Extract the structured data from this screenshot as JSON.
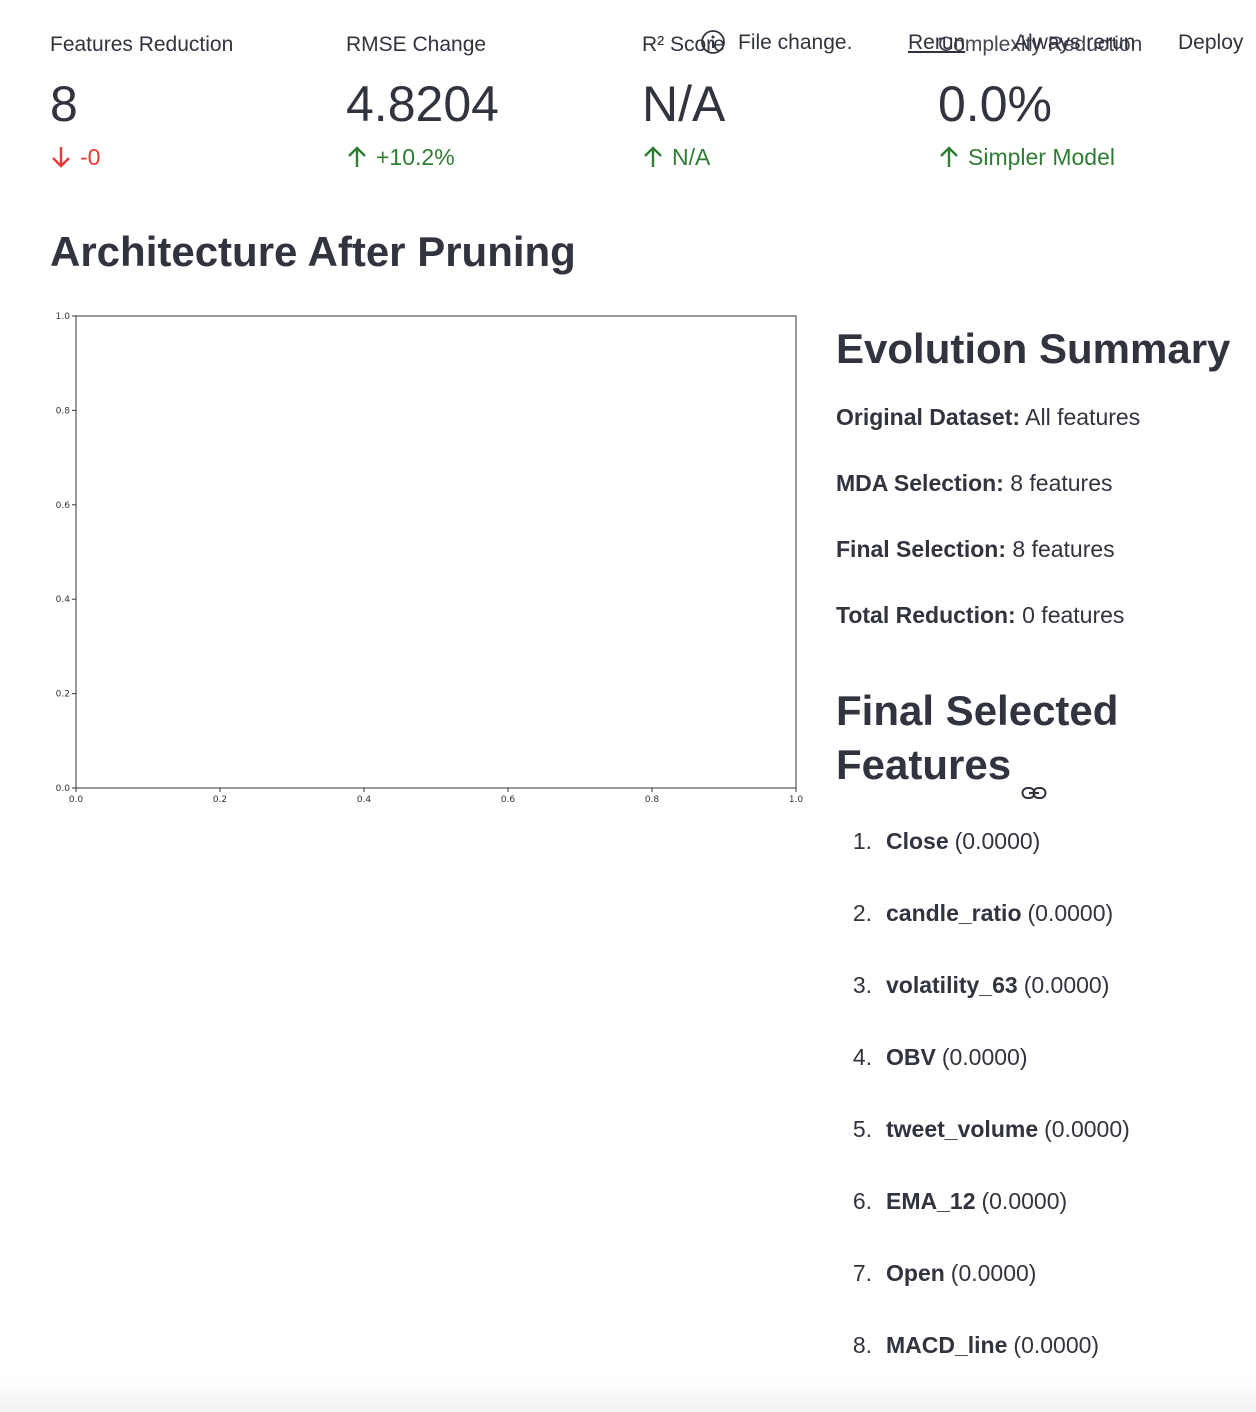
{
  "metrics": [
    {
      "label": "Features Reduction",
      "value": "8",
      "delta": "-0",
      "direction": "down"
    },
    {
      "label": "RMSE Change",
      "value": "4.8204",
      "delta": "+10.2%",
      "direction": "up"
    },
    {
      "label": "R² Score",
      "value": "N/A",
      "delta": "N/A",
      "direction": "up"
    },
    {
      "label": "Complexity Reduction",
      "value": "0.0%",
      "delta": "Simpler Model",
      "direction": "up"
    }
  ],
  "toolbar": {
    "status": "File change.",
    "rerun": "Rerun",
    "always_rerun": "Always rerun",
    "deploy": "Deploy"
  },
  "page": {
    "heading": "Architecture After Pruning"
  },
  "chart_data": {
    "type": "line",
    "series": [],
    "xlim": [
      0.0,
      1.0
    ],
    "ylim": [
      0.0,
      1.0
    ],
    "xticks": [
      "0.0",
      "0.2",
      "0.4",
      "0.6",
      "0.8",
      "1.0"
    ],
    "yticks": [
      "0.0",
      "0.2",
      "0.4",
      "0.6",
      "0.8",
      "1.0"
    ],
    "title": "",
    "xlabel": "",
    "ylabel": "",
    "grid": false
  },
  "summary": {
    "heading": "Evolution Summary",
    "items": [
      {
        "label": "Original Dataset:",
        "value": "All features"
      },
      {
        "label": "MDA Selection:",
        "value": "8 features"
      },
      {
        "label": "Final Selection:",
        "value": "8 features"
      },
      {
        "label": "Total Reduction:",
        "value": "0 features"
      }
    ]
  },
  "features": {
    "heading": "Final Selected Features",
    "items": [
      {
        "num": "1.",
        "name": "Close",
        "score": "(0.0000)"
      },
      {
        "num": "2.",
        "name": "candle_ratio",
        "score": "(0.0000)"
      },
      {
        "num": "3.",
        "name": "volatility_63",
        "score": "(0.0000)"
      },
      {
        "num": "4.",
        "name": "OBV",
        "score": "(0.0000)"
      },
      {
        "num": "5.",
        "name": "tweet_volume",
        "score": "(0.0000)"
      },
      {
        "num": "6.",
        "name": "EMA_12",
        "score": "(0.0000)"
      },
      {
        "num": "7.",
        "name": "Open",
        "score": "(0.0000)"
      },
      {
        "num": "8.",
        "name": "MACD_line",
        "score": "(0.0000)"
      }
    ]
  },
  "colors": {
    "up": "#2e7d32",
    "down": "#e53935",
    "text": "#31333f"
  }
}
